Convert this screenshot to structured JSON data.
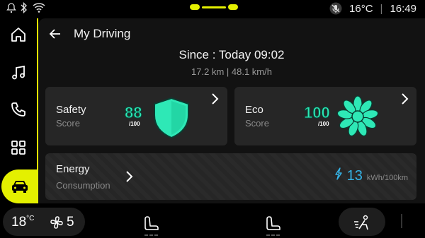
{
  "status_bar": {
    "temperature": "16°C",
    "time": "16:49",
    "icons": [
      "notification-dot-icon",
      "bluetooth-icon",
      "wifi-icon",
      "mic-off-icon"
    ]
  },
  "sidebar": {
    "items": [
      {
        "name": "home-icon"
      },
      {
        "name": "music-icon"
      },
      {
        "name": "phone-icon"
      },
      {
        "name": "apps-grid-icon"
      },
      {
        "name": "car-icon",
        "active": true
      }
    ],
    "accent": "#e4f000"
  },
  "header": {
    "title": "My Driving"
  },
  "summary": {
    "since": "Since : Today 09:02",
    "trip": "17.2 km | 48.1 km/h"
  },
  "cards": {
    "safety": {
      "title": "Safety",
      "subtitle": "Score",
      "score": "88",
      "max": "/100"
    },
    "eco": {
      "title": "Eco",
      "subtitle": "Score",
      "score": "100",
      "max": "/100"
    },
    "energy": {
      "title": "Energy",
      "subtitle": "Consumption",
      "value": "13",
      "unit": "kWh/100km"
    }
  },
  "colors": {
    "score": "#2ee8b6",
    "energy": "#35b4e8"
  },
  "bottom_bar": {
    "temperature": "18",
    "temperature_unit": "°C",
    "fan_level": "5"
  }
}
